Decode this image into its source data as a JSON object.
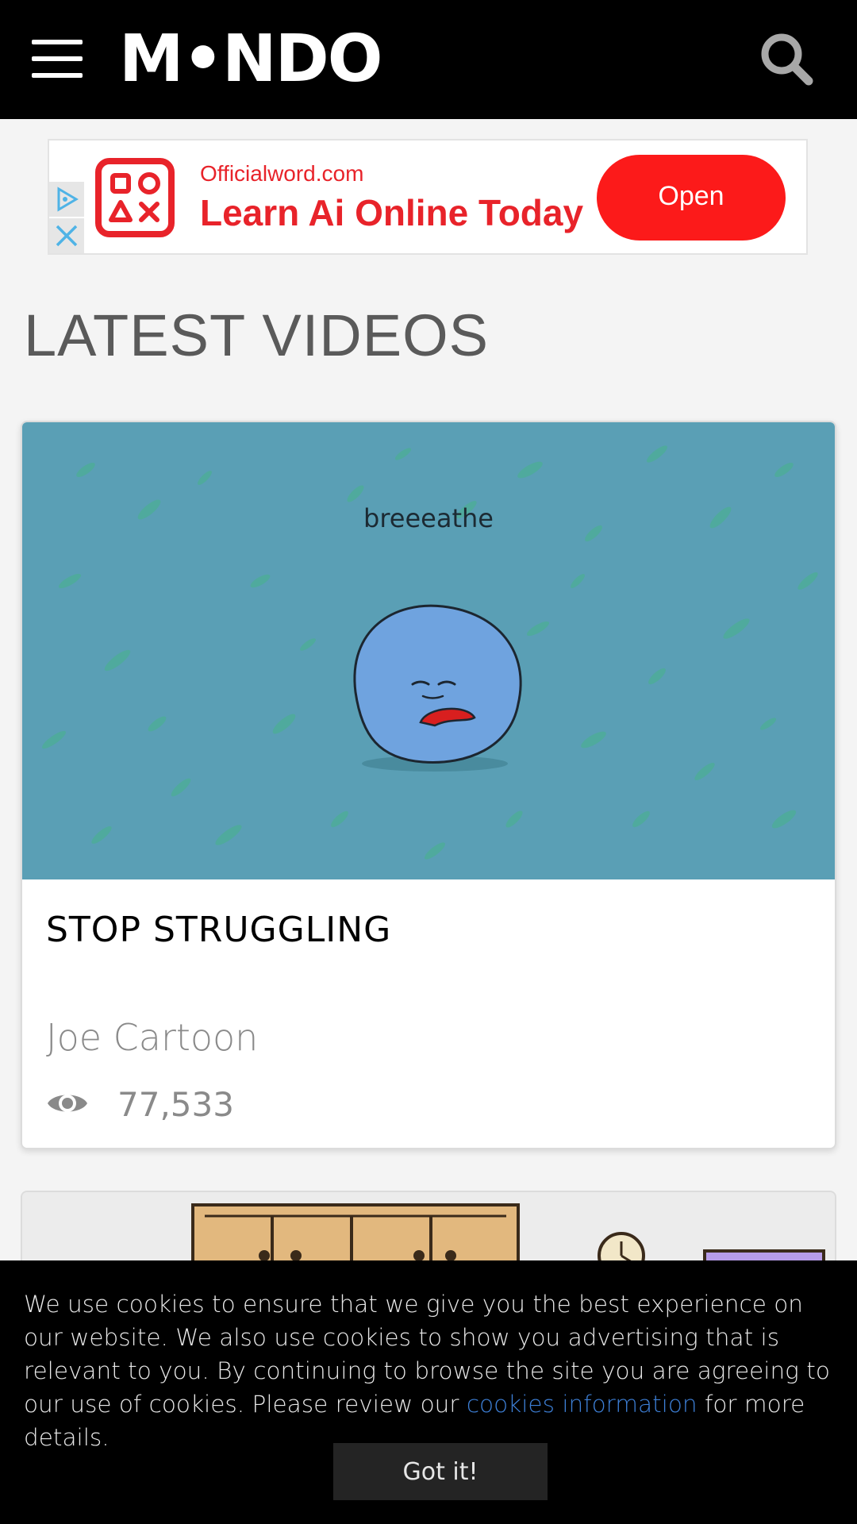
{
  "header": {
    "logo_text": "M•NDO",
    "menu_icon": "hamburger-menu-icon",
    "search_icon": "search-icon"
  },
  "ad": {
    "domain": "Officialword.com",
    "headline": "Learn Ai Online Today",
    "cta_label": "Open",
    "info_icon": "ad-choices-icon",
    "close_icon": "close-icon",
    "brand_color": "#e8232a",
    "button_color": "#fc1a1a"
  },
  "section": {
    "title": "LATEST VIDEOS"
  },
  "videos": [
    {
      "thumbnail_caption": "breeeathe",
      "title": "STOP STRUGGLING",
      "author": "Joe Cartoon",
      "views": "77,533",
      "views_icon": "eye-icon",
      "thumbnail_bg": "#5a9fb5"
    }
  ],
  "cookie_banner": {
    "text_before_link": "We use cookies to ensure that we give you the best experience on our website. We also use cookies to show you advertising that is relevant to you. By continuing to browse the site you are agreeing to our use of cookies. Please review our ",
    "link_text": "cookies information",
    "text_after_link": " for more details.",
    "button_label": "Got it!",
    "link_color": "#3d7fd6"
  }
}
